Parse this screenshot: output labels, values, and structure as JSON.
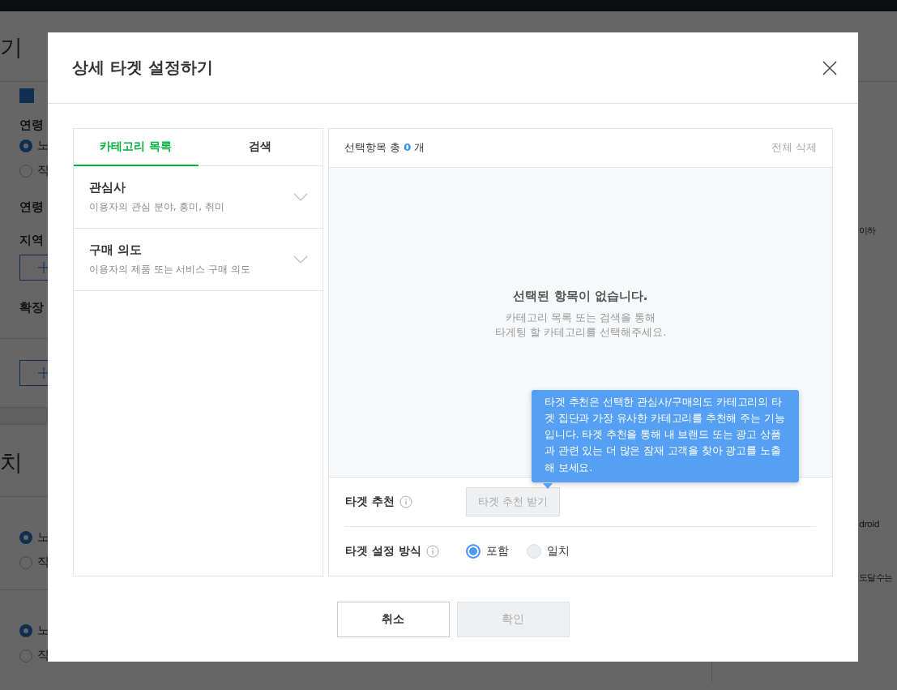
{
  "background": {
    "heading": "기",
    "checkbox": {
      "checked": true
    },
    "age_label": "연령",
    "age_options": [
      {
        "label": "노",
        "selected": true
      },
      {
        "label": "직",
        "selected": false
      }
    ],
    "age_range_label": "연령",
    "region_label": "지역",
    "expand_label": "확장",
    "section_heading": "치",
    "option_groups": [
      [
        {
          "label": "노",
          "selected": true
        },
        {
          "label": "직",
          "selected": false
        }
      ],
      [
        {
          "label": "노",
          "selected": true
        },
        {
          "label": "직",
          "selected": false
        }
      ]
    ],
    "side_texts": [
      "이하",
      "droid",
      "도달수는"
    ]
  },
  "dialog": {
    "title": "상세 타겟 설정하기",
    "tabs": [
      {
        "label": "카테고리 목록",
        "selected": true
      },
      {
        "label": "검색",
        "selected": false
      }
    ],
    "categories": [
      {
        "name": "관심사",
        "description": "이용자의 관심 분야, 흥미, 취미",
        "expanded": false
      },
      {
        "name": "구매 의도",
        "description": "이용자의 제품 또는 서비스 구매 의도",
        "expanded": false
      }
    ],
    "selection": {
      "summary": "선택항목 총 **0** 개",
      "clear_all": "전체 삭제",
      "empty_title": "선택된 항목이 없습니다.",
      "empty_description": "카테고리 목록 또는 검색을 통해\n타게팅 할 카테고리를 선택해주세요."
    },
    "recommend": {
      "label": "타겟 추천",
      "button": "타겟 추천 받기",
      "button_disabled": true,
      "tooltip": "타겟 추천은 선택한 관심사/구매의도 카테고리의 타겟 집단과 가장 유사한 카테고리를 추천해 주는 기능입니다. 타겟 추천을 통해 내 브랜드 또는 광고 상품과 관련 있는 더 많은 잠재 고객을 찾아 광고를 노출해 보세요."
    },
    "method": {
      "label": "타겟 설정 방식",
      "options": [
        {
          "label": "포함",
          "selected": true
        },
        {
          "label": "일치",
          "selected": false
        }
      ]
    },
    "buttons": [
      {
        "label": "취소",
        "disabled": false
      },
      {
        "label": "확인",
        "disabled": true
      }
    ]
  }
}
